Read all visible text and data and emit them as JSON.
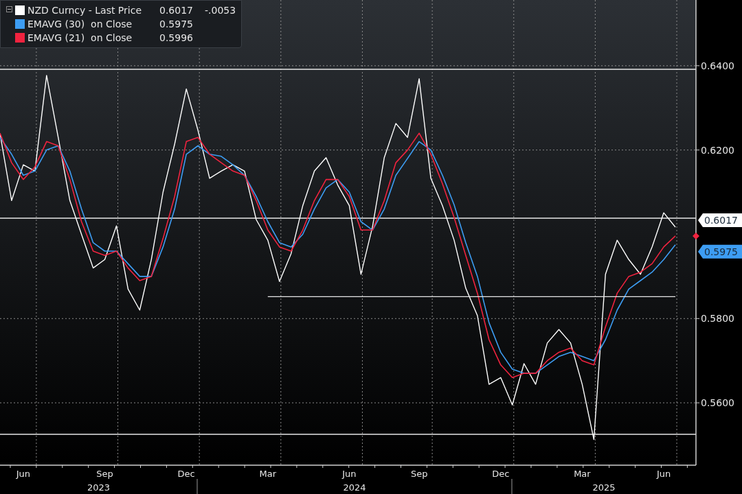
{
  "legend": {
    "expanded": true,
    "items": [
      {
        "value": "0.6017",
        "change": "-.0053"
      },
      {
        "value": "0.5975"
      },
      {
        "value": "0.5996"
      }
    ]
  },
  "chart": {
    "chart_data": {
      "type": "line",
      "categories": [
        null,
        null,
        "Jun",
        null,
        null,
        null,
        null,
        null,
        null,
        "Sep",
        null,
        null,
        null,
        null,
        null,
        null,
        "Dec",
        null,
        null,
        null,
        null,
        null,
        null,
        "Mar",
        null,
        null,
        null,
        null,
        null,
        null,
        "Jun",
        null,
        null,
        null,
        null,
        null,
        "Sep",
        null,
        null,
        null,
        null,
        null,
        null,
        "Dec",
        null,
        null,
        null,
        null,
        null,
        null,
        "Mar",
        null,
        null,
        null,
        null,
        null,
        null,
        "Jun",
        null
      ],
      "series": [
        {
          "name": "NZD Curncy - Last Price",
          "color": "#ffffff",
          "values": [
            0.6239,
            0.608,
            0.6165,
            0.615,
            0.6377,
            0.623,
            0.608,
            0.6,
            0.592,
            0.594,
            0.602,
            0.587,
            0.582,
            0.594,
            0.61,
            0.6214,
            0.6345,
            0.6247,
            0.6133,
            0.615,
            0.6165,
            0.615,
            0.6035,
            0.5986,
            0.5888,
            0.5954,
            0.6068,
            0.615,
            0.6182,
            0.6117,
            0.6068,
            0.5905,
            0.6019,
            0.6182,
            0.6263,
            0.623,
            0.6369,
            0.6133,
            0.6068,
            0.5986,
            0.5872,
            0.5807,
            0.5644,
            0.566,
            0.5595,
            0.5693,
            0.5644,
            0.5742,
            0.5774,
            0.5742,
            0.5644,
            0.5513,
            0.5905,
            0.5986,
            0.594,
            0.5905,
            0.597,
            0.6051,
            0.6017
          ]
        },
        {
          "name": "EMAVG (30)  on Close",
          "color": "#3d9df3",
          "values": [
            0.623,
            0.619,
            0.614,
            0.615,
            0.62,
            0.621,
            0.615,
            0.606,
            0.598,
            0.596,
            0.596,
            0.593,
            0.59,
            0.59,
            0.597,
            0.606,
            0.619,
            0.621,
            0.619,
            0.6185,
            0.6165,
            0.614,
            0.609,
            0.603,
            0.598,
            0.597,
            0.6,
            0.606,
            0.611,
            0.613,
            0.61,
            0.603,
            0.601,
            0.606,
            0.614,
            0.618,
            0.622,
            0.62,
            0.614,
            0.607,
            0.598,
            0.59,
            0.579,
            0.572,
            0.568,
            0.567,
            0.567,
            0.569,
            0.571,
            0.572,
            0.571,
            0.57,
            0.575,
            0.582,
            0.587,
            0.589,
            0.591,
            0.594,
            0.5975
          ]
        },
        {
          "name": "EMAVG (21)  on Close",
          "color": "#f0233f",
          "values": [
            0.624,
            0.617,
            0.613,
            0.616,
            0.622,
            0.621,
            0.613,
            0.603,
            0.596,
            0.595,
            0.596,
            0.592,
            0.589,
            0.59,
            0.599,
            0.609,
            0.622,
            0.623,
            0.619,
            0.617,
            0.615,
            0.614,
            0.608,
            0.601,
            0.597,
            0.596,
            0.601,
            0.608,
            0.613,
            0.613,
            0.609,
            0.601,
            0.601,
            0.608,
            0.617,
            0.62,
            0.624,
            0.619,
            0.612,
            0.604,
            0.595,
            0.586,
            0.575,
            0.569,
            0.566,
            0.567,
            0.567,
            0.57,
            0.572,
            0.573,
            0.57,
            0.569,
            0.578,
            0.586,
            0.59,
            0.591,
            0.593,
            0.597,
            0.5996
          ]
        },
        {
          "color": "#e8e8e8",
          "values": [
            null,
            null,
            null,
            null,
            null,
            null,
            null,
            null,
            null,
            null,
            null,
            null,
            null,
            null,
            null,
            null,
            null,
            null,
            null,
            null,
            null,
            null,
            null,
            0.5852,
            0.5852,
            0.5852,
            0.5852,
            0.5852,
            0.5852,
            0.5852,
            0.5852,
            0.5852,
            0.5852,
            0.5852,
            0.5852,
            0.5852,
            0.5852,
            0.5852,
            0.5852,
            0.5852,
            0.5852,
            0.5852,
            0.5852,
            0.5852,
            0.5852,
            0.5852,
            0.5852,
            0.5852,
            0.5852,
            0.5852,
            0.5852,
            0.5852,
            0.5852,
            0.5852,
            0.5852,
            0.5852,
            0.5852,
            0.5852,
            0.5852
          ]
        }
      ],
      "ylim": [
        0.5452,
        0.6556
      ],
      "yticks": [
        {
          "value": 0.64,
          "label": "0.6400"
        },
        {
          "value": 0.62,
          "label": "0.6200"
        },
        {
          "value": 0.58,
          "label": "0.5800"
        },
        {
          "value": 0.56,
          "label": "0.5600"
        }
      ],
      "grid": true
    },
    "years": [
      {
        "label": "2023"
      },
      {
        "label": "2024"
      },
      {
        "label": "2025"
      }
    ],
    "last_value_tags": [
      {
        "label": "0.6017"
      },
      {
        "label": "0.5975"
      }
    ]
  }
}
